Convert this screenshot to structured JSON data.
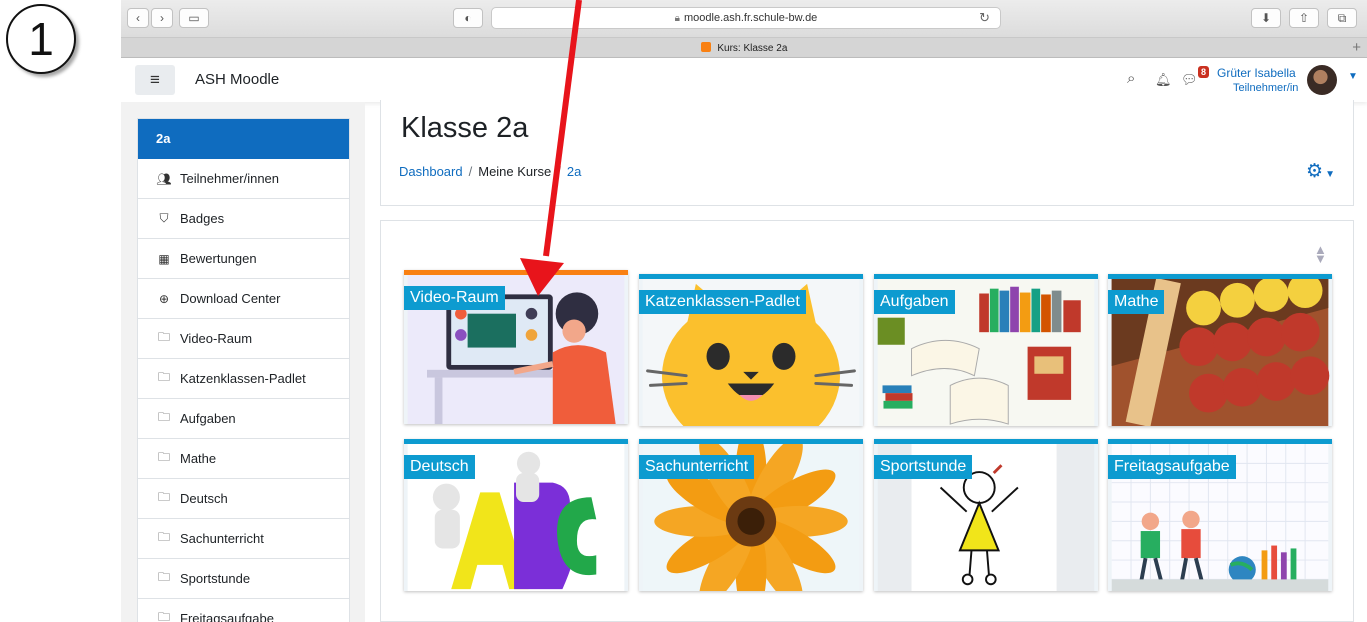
{
  "step": {
    "number": "1"
  },
  "browser": {
    "url": "moodle.ash.fr.schule-bw.de",
    "tab_title": "Kurs: Klasse 2a"
  },
  "navbar": {
    "site_name": "ASH Moodle",
    "message_count": "8",
    "user_name": "Grüter Isabella",
    "user_role": "Teilnehmer/in"
  },
  "drawer": {
    "items": [
      {
        "label": "2a",
        "icon": "course-icon"
      },
      {
        "label": "Teilnehmer/innen",
        "icon": "users-icon"
      },
      {
        "label": "Badges",
        "icon": "shield-icon"
      },
      {
        "label": "Bewertungen",
        "icon": "table-icon"
      },
      {
        "label": "Download Center",
        "icon": "download-icon"
      },
      {
        "label": "Video-Raum",
        "icon": "folder-icon"
      },
      {
        "label": "Katzenklassen-Padlet",
        "icon": "folder-icon"
      },
      {
        "label": "Aufgaben",
        "icon": "folder-icon"
      },
      {
        "label": "Mathe",
        "icon": "folder-icon"
      },
      {
        "label": "Deutsch",
        "icon": "folder-icon"
      },
      {
        "label": "Sachunterricht",
        "icon": "folder-icon"
      },
      {
        "label": "Sportstunde",
        "icon": "folder-icon"
      },
      {
        "label": "Freitagsaufgabe",
        "icon": "folder-icon"
      }
    ]
  },
  "header": {
    "title": "Klasse 2a",
    "breadcrumb": [
      "Dashboard",
      "Meine Kurse",
      "2a"
    ]
  },
  "tiles": [
    {
      "label": "Video-Raum"
    },
    {
      "label": "Katzenklassen-Padlet"
    },
    {
      "label": "Aufgaben"
    },
    {
      "label": "Mathe"
    },
    {
      "label": "Deutsch"
    },
    {
      "label": "Sachunterricht"
    },
    {
      "label": "Sportstunde"
    },
    {
      "label": "Freitagsaufgabe"
    }
  ],
  "colors": {
    "accent": "#0f6cbf",
    "tile_label": "#0d9bd0",
    "highlight": "#f98012",
    "arrow": "#e8141b"
  }
}
